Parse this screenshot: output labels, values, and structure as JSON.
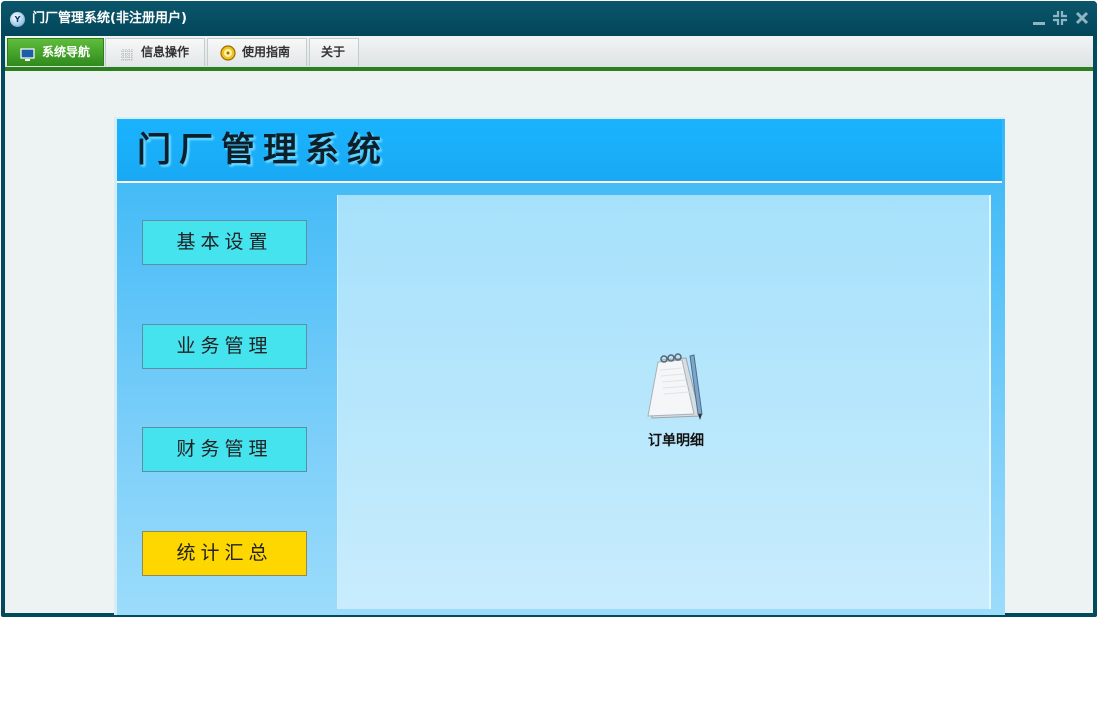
{
  "window": {
    "title": "门厂管理系统(非注册用户)",
    "app_icon_text": "Y"
  },
  "tabs": [
    {
      "label": "系统导航",
      "icon": "monitor-icon",
      "active": true
    },
    {
      "label": "信息操作",
      "icon": "grid-icon",
      "active": false
    },
    {
      "label": "使用指南",
      "icon": "compass-icon",
      "active": false
    },
    {
      "label": "关于",
      "icon": "",
      "active": false
    }
  ],
  "panel": {
    "title": "门厂管理系统",
    "nav_buttons": [
      {
        "label": "基本设置",
        "selected": false
      },
      {
        "label": "业务管理",
        "selected": false
      },
      {
        "label": "财务管理",
        "selected": false
      },
      {
        "label": "统计汇总",
        "selected": true
      }
    ],
    "items": [
      {
        "label": "订单明细",
        "icon": "notepad-icon"
      }
    ]
  },
  "colors": {
    "titlebar": "#034a5e",
    "active_tab": "#3a9a24",
    "panel_blue": "#1ab3fe",
    "nav_button": "#44e3ee",
    "nav_button_selected": "#ffd700"
  }
}
